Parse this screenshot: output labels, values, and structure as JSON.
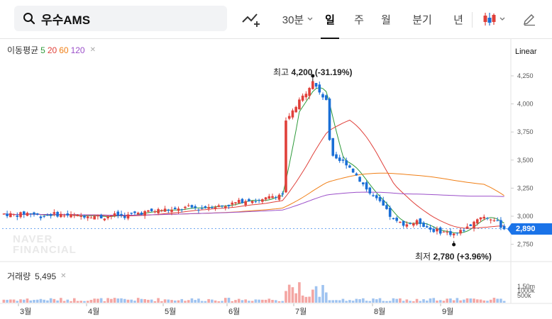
{
  "toolbar": {
    "stock_name": "우수AMS",
    "interval": "30분",
    "periods": [
      "일",
      "주",
      "월",
      "분기",
      "년"
    ],
    "active_period": "일"
  },
  "ma_legend": {
    "label": "이동평균",
    "periods": [
      "5",
      "20",
      "60",
      "120"
    ]
  },
  "scale_mode": "Linear",
  "price_axis_ticks": [
    "4,250",
    "4,000",
    "3,750",
    "3,500",
    "3,250",
    "3,000",
    "2,750"
  ],
  "volume_axis_ticks": [
    "1.50m",
    "1000k",
    "500k"
  ],
  "x_axis_months": [
    "3월",
    "4월",
    "5월",
    "6월",
    "7월",
    "8월",
    "9월"
  ],
  "high_annotation": {
    "label": "최고",
    "value": "4,200",
    "change": "(-31.19%)"
  },
  "low_annotation": {
    "label": "최저",
    "value": "2,780",
    "change": "(+3.96%)"
  },
  "current_price": "2,890",
  "volume_label": "거래량",
  "volume_value": "5,495",
  "watermark": [
    "NAVER",
    "FINANCIAL"
  ],
  "colors": {
    "up": "#e0403a",
    "down": "#1a6fd6",
    "ma5": "#2e9a3a",
    "ma20": "#e0403a",
    "ma60": "#f07f16",
    "ma120": "#9b4fc9",
    "price_tag": "#1a73e8"
  },
  "chart_data": {
    "type": "candlestick",
    "ylim": [
      2700,
      4300
    ],
    "closes_by_month": [
      {
        "month": "3월",
        "close": [
          3020,
          3010,
          3030,
          3000,
          3020,
          3010
        ]
      },
      {
        "month": "4월",
        "close": [
          3000,
          3010,
          2990,
          3010,
          3000,
          3030
        ]
      },
      {
        "month": "5월",
        "close": [
          3040,
          3060,
          3050,
          3080,
          3070,
          3090
        ]
      },
      {
        "month": "6월",
        "close": [
          3090,
          3120,
          3150,
          3130,
          3180,
          3200
        ]
      },
      {
        "month": "7월",
        "close": [
          3650,
          3950,
          4100,
          3500,
          3480,
          3350
        ]
      },
      {
        "month": "8월",
        "close": [
          3200,
          3100,
          2950,
          2930,
          2950,
          2880
        ]
      },
      {
        "month": "9월",
        "close": [
          2860,
          2840,
          2900,
          3000,
          2980,
          2890
        ]
      }
    ],
    "high": 4200,
    "low": 2780,
    "last": 2890
  }
}
